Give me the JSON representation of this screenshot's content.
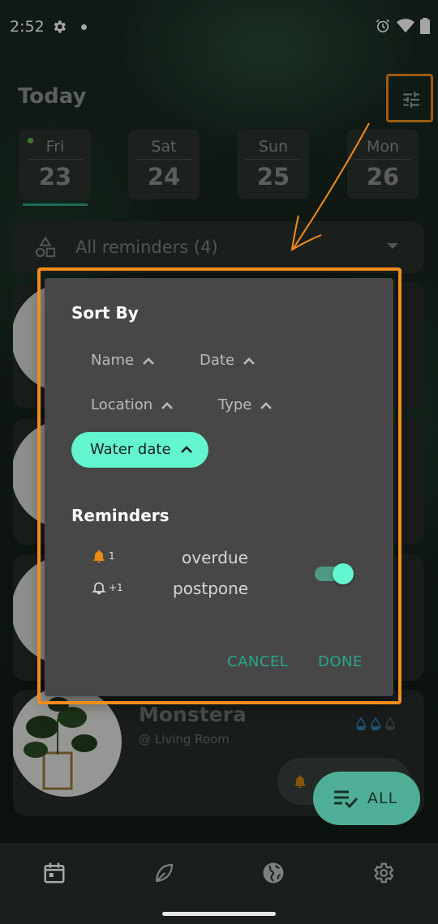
{
  "status_bar": {
    "time": "2:52",
    "icons": [
      "gear-icon",
      "notification-dot",
      "alarm-icon",
      "wifi-icon",
      "battery-icon"
    ]
  },
  "header": {
    "title": "Today",
    "filter_icon": "tune-icon"
  },
  "days": [
    {
      "name": "Fri",
      "num": "23",
      "selected": true
    },
    {
      "name": "Sat",
      "num": "24",
      "selected": false
    },
    {
      "name": "Sun",
      "num": "25",
      "selected": false
    },
    {
      "name": "Mon",
      "num": "26",
      "selected": false
    }
  ],
  "filter_dropdown": {
    "label": "All reminders (4)",
    "icon": "shapes-icon"
  },
  "plant_card": {
    "name": "Monstera",
    "location": "@ Living Room"
  },
  "fab": {
    "label": "ALL",
    "icon": "playlist-check-icon"
  },
  "bottom_nav": [
    "calendar-icon",
    "leaf-icon",
    "globe-icon",
    "gear-icon"
  ],
  "dialog": {
    "sort_title": "Sort By",
    "sort_options": [
      {
        "label": "Name",
        "selected": false
      },
      {
        "label": "Date",
        "selected": false
      },
      {
        "label": "Location",
        "selected": false
      },
      {
        "label": "Type",
        "selected": false
      },
      {
        "label": "Water date",
        "selected": true
      }
    ],
    "reminders_title": "Reminders",
    "reminders": [
      {
        "count": "1",
        "label": "overdue"
      },
      {
        "count": "+1",
        "label": "postpone"
      }
    ],
    "toggle_on": true,
    "cancel_label": "CANCEL",
    "done_label": "DONE"
  },
  "colors": {
    "accent": "#62f5cf",
    "annotation": "#f28c1c",
    "dialog_bg": "#464746",
    "button_text": "#2aa58e"
  }
}
